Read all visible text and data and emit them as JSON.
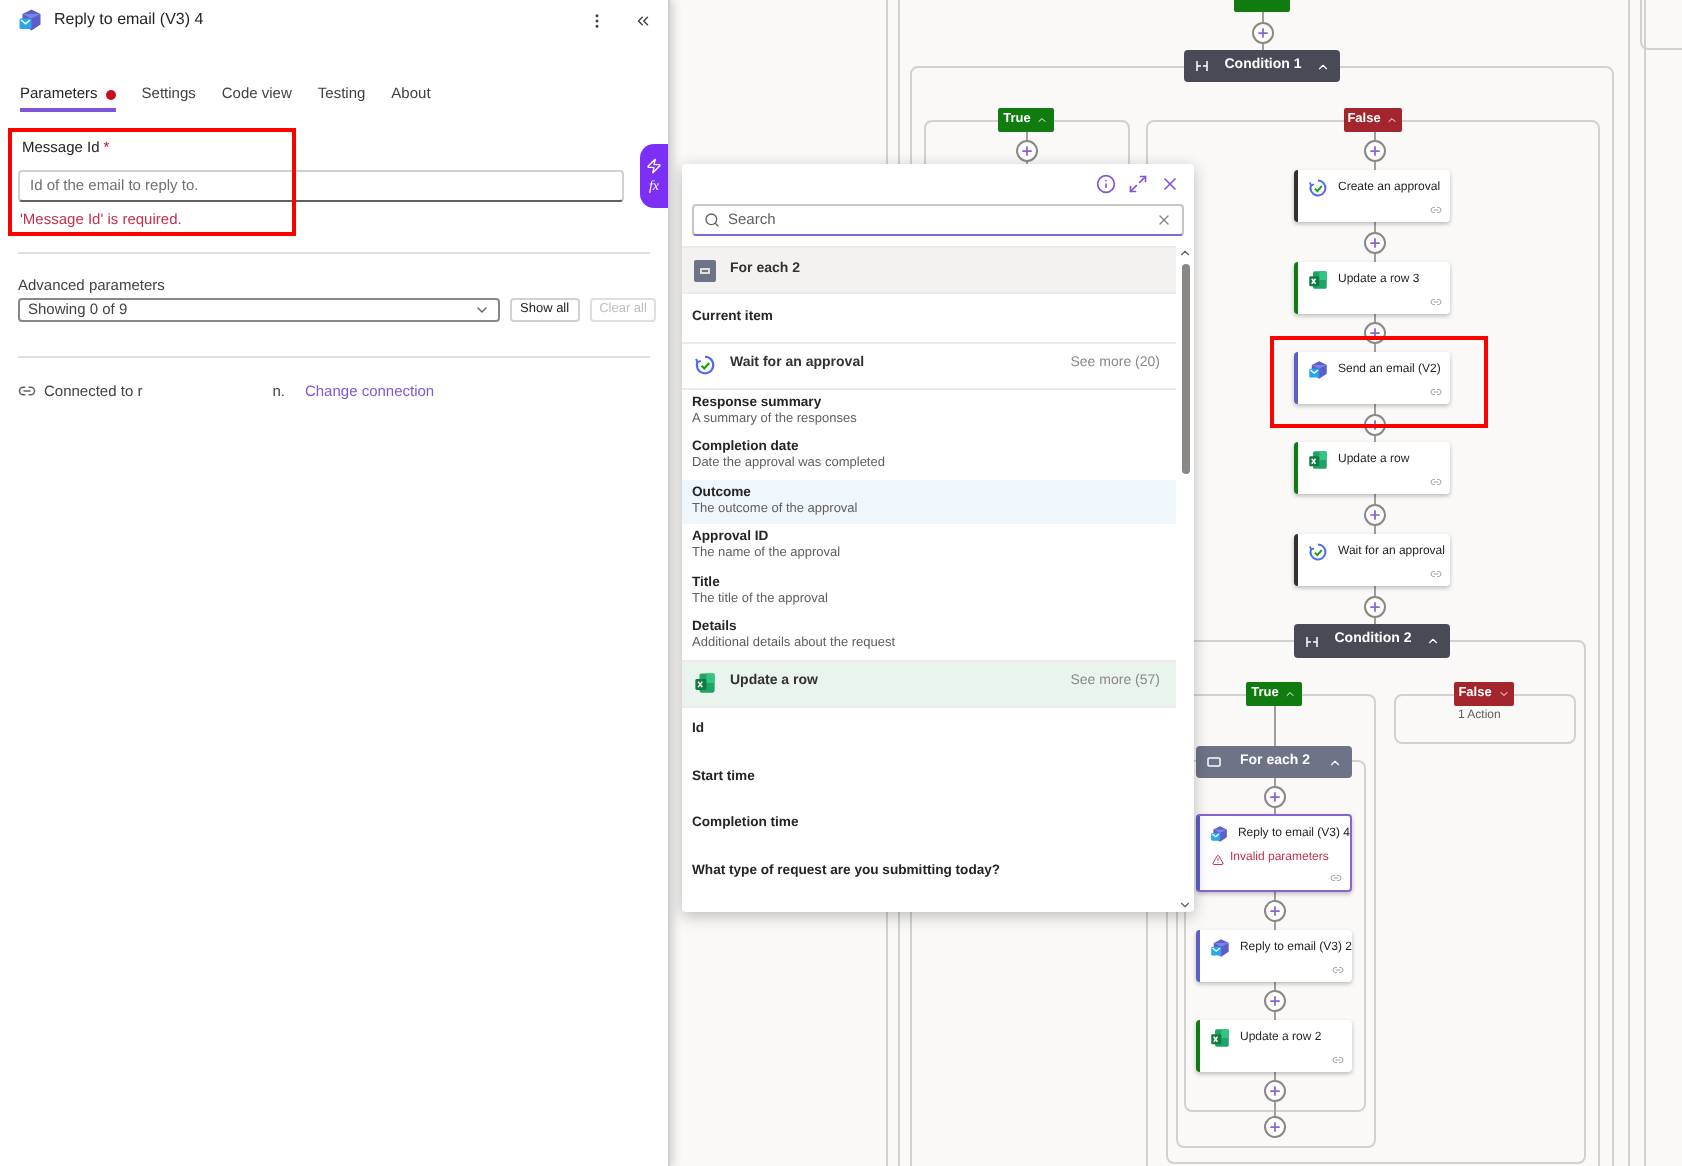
{
  "panel": {
    "title": "Reply to email (V3) 4",
    "tabs": [
      {
        "label": "Parameters",
        "selected": true,
        "alert": true
      },
      {
        "label": "Settings",
        "selected": false,
        "alert": false
      },
      {
        "label": "Code view",
        "selected": false,
        "alert": false
      },
      {
        "label": "Testing",
        "selected": false,
        "alert": false
      },
      {
        "label": "About",
        "selected": false,
        "alert": false
      }
    ],
    "message_id": {
      "label": "Message Id",
      "required_mark": "*",
      "placeholder": "Id of the email to reply to.",
      "error": "'Message Id' is required.",
      "annotated": true
    },
    "function_glyph": "fx",
    "advanced": {
      "label": "Advanced parameters",
      "value": "Showing 0 of 9",
      "buttons": [
        {
          "label": "Show all",
          "disabled": false
        },
        {
          "label": "Clear all",
          "disabled": true
        }
      ]
    },
    "connection": {
      "text": "Connected to r",
      "text_end": "n.",
      "link": "Change connection"
    }
  },
  "token_picker": {
    "search": {
      "placeholder": "Search"
    },
    "rows": [
      {
        "kind": "loop",
        "title": "For each 2"
      },
      {
        "kind": "field",
        "title": "Current item",
        "selected": false
      },
      {
        "kind": "approval",
        "title": "Wait for an approval",
        "see_more": "See more (20)"
      },
      {
        "kind": "field",
        "title": "Response summary",
        "description": "A summary of the responses",
        "selected": false
      },
      {
        "kind": "field",
        "title": "Completion date",
        "description": "Date the approval was completed",
        "selected": false
      },
      {
        "kind": "field",
        "title": "Outcome",
        "description": "The outcome of the approval",
        "selected": true
      },
      {
        "kind": "field",
        "title": "Approval ID",
        "description": "The name of the approval",
        "selected": false
      },
      {
        "kind": "field",
        "title": "Title",
        "description": "The title of the approval",
        "selected": false
      },
      {
        "kind": "field",
        "title": "Details",
        "description": "Additional details about the request",
        "selected": false
      },
      {
        "kind": "sheet",
        "title": "Update a row",
        "see_more": "See more (57)"
      },
      {
        "kind": "field",
        "title": "Id",
        "selected": false
      },
      {
        "kind": "field",
        "title": "Start time",
        "selected": false
      },
      {
        "kind": "field",
        "title": "Completion time",
        "selected": false
      },
      {
        "kind": "field",
        "title": "What type of request are you submitting today?",
        "selected": false
      }
    ]
  },
  "canvas": {
    "nodes": [
      {
        "kind": "condition",
        "title": "Condition 1",
        "expanded": true
      },
      {
        "kind": "branch",
        "label": "True",
        "color": "#107c10",
        "expanded": true
      },
      {
        "kind": "branch",
        "label": "False",
        "color": "#a4262c",
        "expanded": true
      },
      {
        "kind": "approval",
        "title": "Create an approval",
        "selected": false,
        "annotated": false
      },
      {
        "kind": "sheet",
        "title": "Update a row 3",
        "selected": false,
        "annotated": false
      },
      {
        "kind": "mail",
        "title": "Send an email (V2)",
        "selected": false,
        "annotated": true
      },
      {
        "kind": "sheet",
        "title": "Update a row",
        "selected": false,
        "annotated": false
      },
      {
        "kind": "approval",
        "title": "Wait for an approval",
        "selected": false,
        "annotated": false
      },
      {
        "kind": "condition",
        "title": "Condition 2",
        "expanded": true
      },
      {
        "kind": "branch",
        "label": "True",
        "color": "#107c10",
        "expanded": true
      },
      {
        "kind": "branch",
        "label": "False",
        "color": "#a4262c",
        "expanded": false,
        "summary": "1 Action"
      },
      {
        "kind": "loop",
        "title": "For each 2",
        "expanded": true
      },
      {
        "kind": "mail",
        "title": "Reply to email (V3) 4",
        "selected": true,
        "annotated": false,
        "error": "Invalid parameters"
      },
      {
        "kind": "mail",
        "title": "Reply to email (V3) 2",
        "selected": false,
        "annotated": false
      },
      {
        "kind": "sheet",
        "title": "Update a row 2",
        "selected": false,
        "annotated": false
      }
    ]
  }
}
